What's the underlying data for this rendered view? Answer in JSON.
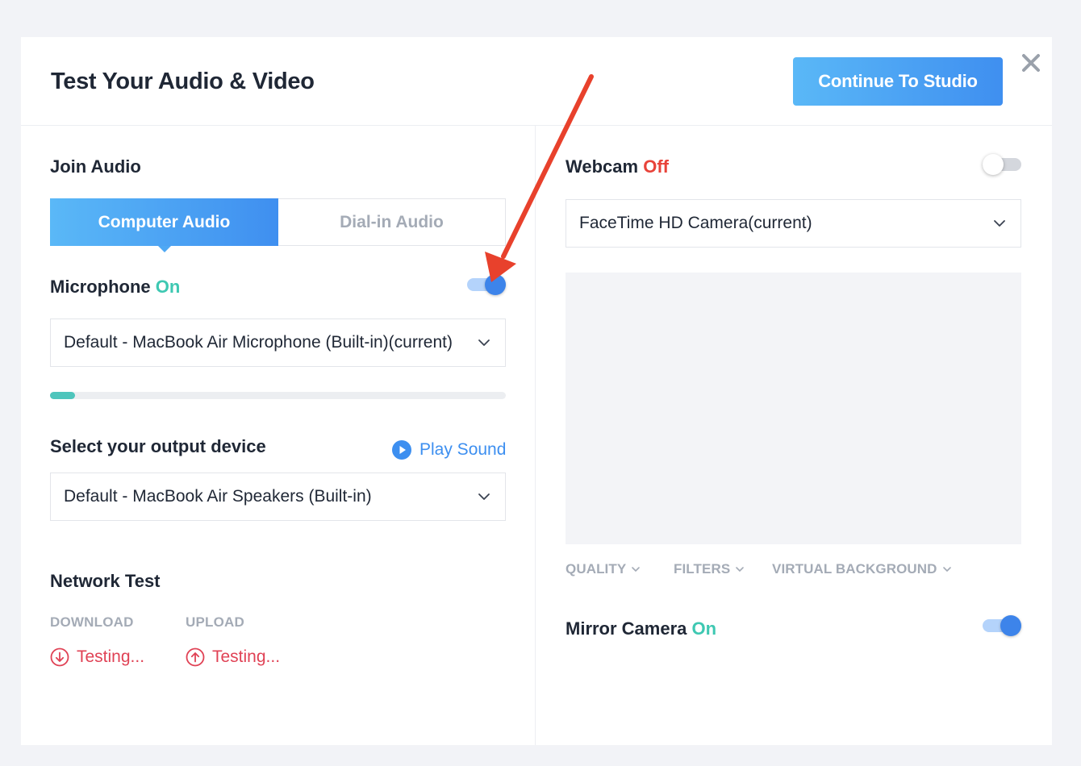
{
  "header": {
    "title": "Test Your Audio & Video",
    "continue_label": "Continue To Studio"
  },
  "audio": {
    "join_label": "Join Audio",
    "tabs": [
      {
        "label": "Computer Audio",
        "active": true
      },
      {
        "label": "Dial-in Audio",
        "active": false
      }
    ],
    "microphone": {
      "label": "Microphone",
      "state": "On",
      "enabled": true,
      "device": "Default - MacBook Air Microphone (Built-in)(current)",
      "input_level": 0.055
    },
    "output": {
      "label": "Select your output device",
      "play_sound_label": "Play Sound",
      "device": "Default - MacBook Air Speakers (Built-in)"
    }
  },
  "network": {
    "label": "Network Test",
    "download_label": "DOWNLOAD",
    "upload_label": "UPLOAD",
    "download_status": "Testing...",
    "upload_status": "Testing..."
  },
  "video": {
    "webcam": {
      "label": "Webcam",
      "state": "Off",
      "enabled": false,
      "device": "FaceTime HD Camera(current)"
    },
    "options": {
      "quality": "QUALITY",
      "filters": "FILTERS",
      "virtual_background": "VIRTUAL BACKGROUND"
    },
    "mirror": {
      "label": "Mirror Camera",
      "state": "On",
      "enabled": true
    }
  },
  "colors": {
    "accent_blue": "#3d8ff0",
    "on_green": "#3ec8b2",
    "off_red": "#e8433a",
    "testing_red": "#e04255",
    "annotation_arrow": "#e8412c"
  },
  "icons": {
    "close": "close-icon",
    "chevron": "chevron-down-icon",
    "play": "play-circle-icon",
    "download": "arrow-down-circle-icon",
    "upload": "arrow-up-circle-icon"
  }
}
